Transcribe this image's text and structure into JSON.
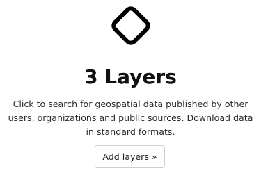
{
  "panel": {
    "icon": "diamond-icon",
    "title": "3 Layers",
    "description": "Click to search for geospatial data published by other users, organizations and public sources. Download data in standard formats.",
    "add_button_label": "Add layers »"
  },
  "colors": {
    "icon_stroke": "#000000",
    "title_text": "#111111",
    "body_text": "#2a2a2a",
    "button_border": "#cfcfcf",
    "background": "#ffffff"
  }
}
